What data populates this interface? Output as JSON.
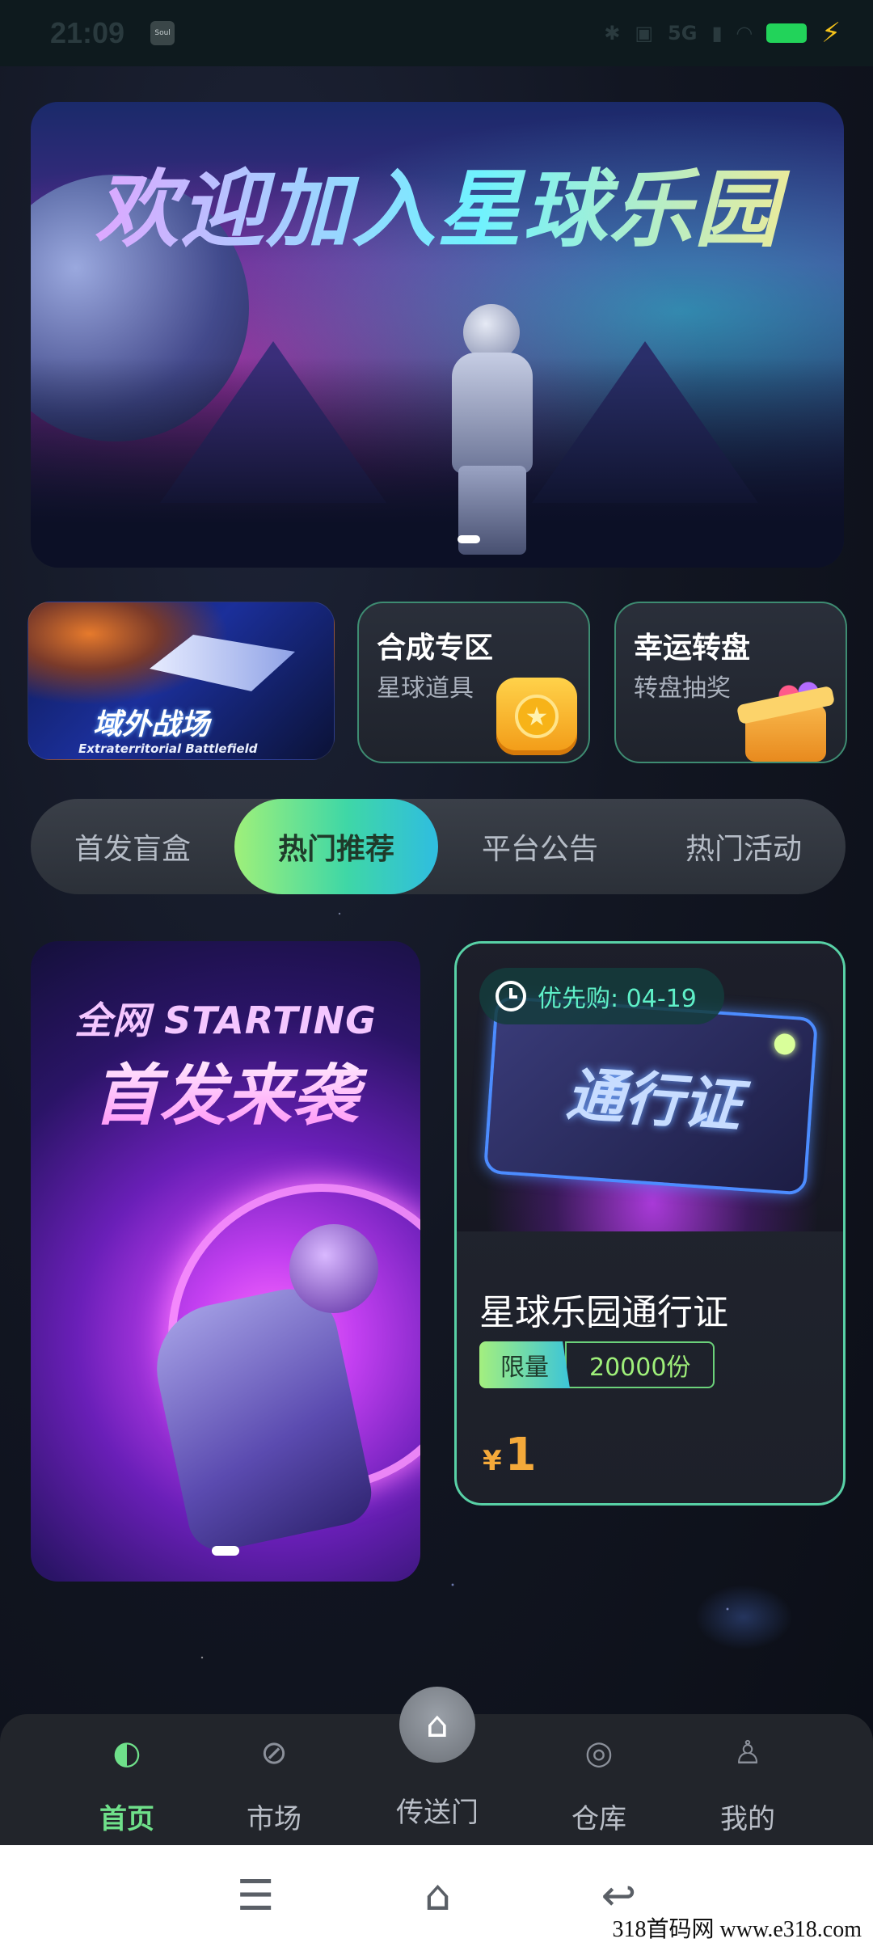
{
  "status_bar": {
    "time": "21:09",
    "app_icon": "Soul",
    "network": "5G",
    "icons": [
      "bluetooth-icon",
      "hd-icon",
      "signal-icon",
      "wifi-icon",
      "battery-icon",
      "charging-icon"
    ]
  },
  "hero_banner": {
    "title": "欢迎加入星球乐园",
    "indicator_dots": 1
  },
  "features": {
    "battle": {
      "title": "域外战场",
      "subtitle": "Extraterritorial Battlefield"
    },
    "synth": {
      "title": "合成专区",
      "subtitle": "星球道具",
      "icon": "coin-icon"
    },
    "wheel": {
      "title": "幸运转盘",
      "subtitle": "转盘抽奖",
      "icon": "gift-icon"
    }
  },
  "tabs": [
    {
      "label": "首发盲盒",
      "active": false
    },
    {
      "label": "热门推荐",
      "active": true
    },
    {
      "label": "平台公告",
      "active": false
    },
    {
      "label": "热门活动",
      "active": false
    }
  ],
  "promo": {
    "line1": "全网 STARTING",
    "line2": "首发来袭"
  },
  "product": {
    "badge": "优先购: 04-19",
    "image_text": "通行证",
    "name": "星球乐园通行证",
    "tag_limit": "限量",
    "tag_qty": "20000份",
    "price_symbol": "¥",
    "price": "1"
  },
  "bottom_nav": {
    "items": [
      {
        "label": "首页",
        "icon": "home-visor-icon",
        "active": true
      },
      {
        "label": "市场",
        "icon": "market-planet-icon",
        "active": false
      },
      {
        "label": "传送门",
        "icon": "ufo-portal-icon",
        "active": false
      },
      {
        "label": "仓库",
        "icon": "warehouse-orbit-icon",
        "active": false
      },
      {
        "label": "我的",
        "icon": "astronaut-profile-icon",
        "active": false
      }
    ]
  },
  "system_nav": {
    "icons": [
      "menu-icon",
      "home-icon",
      "back-icon"
    ]
  },
  "watermark": "318首码网 www.e318.com"
}
